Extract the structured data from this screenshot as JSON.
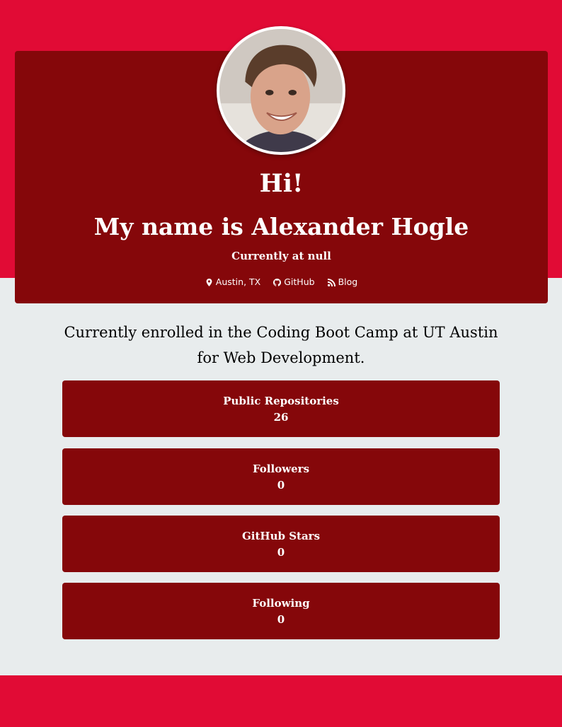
{
  "colors": {
    "accent_band": "#e10b35",
    "card": "#85070a",
    "page_background": "#e8eced",
    "text_on_card": "#ffffff"
  },
  "header": {
    "greeting": "Hi!",
    "name": "My name is Alexander Hogle",
    "company": "Currently at null",
    "links": [
      {
        "label": "Austin, TX",
        "icon": "map-marker-icon"
      },
      {
        "label": "GitHub",
        "icon": "github-icon"
      },
      {
        "label": "Blog",
        "icon": "rss-icon"
      }
    ]
  },
  "bio": "Currently enrolled in the Coding Boot Camp at UT Austin for Web Development.",
  "stats": [
    {
      "label": "Public Repositories",
      "value": "26"
    },
    {
      "label": "Followers",
      "value": "0"
    },
    {
      "label": "GitHub Stars",
      "value": "0"
    },
    {
      "label": "Following",
      "value": "0"
    }
  ]
}
